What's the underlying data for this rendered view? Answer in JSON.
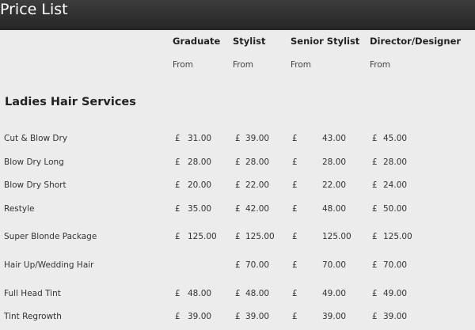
{
  "header": {
    "title": "Price List"
  },
  "columns": [
    {
      "label": "Graduate",
      "from": "From"
    },
    {
      "label": "Stylist",
      "from": "From"
    },
    {
      "label": "Senior Stylist",
      "from": "From"
    },
    {
      "label": "Director/Designer",
      "from": "From"
    }
  ],
  "section": {
    "title": "Ladies Hair Services"
  },
  "currency": "£",
  "services": [
    {
      "name": "Cut & Blow Dry",
      "prices": [
        "31.00",
        "39.00",
        "43.00",
        "45.00"
      ]
    },
    {
      "name": "Blow Dry Long",
      "prices": [
        "28.00",
        "28.00",
        "28.00",
        "28.00"
      ]
    },
    {
      "name": "Blow Dry Short",
      "prices": [
        "20.00",
        "22.00",
        "22.00",
        "24.00"
      ]
    },
    {
      "name": "Restyle",
      "prices": [
        "35.00",
        "42.00",
        "48.00",
        "50.00"
      ]
    },
    {
      "name": "Super Blonde Package",
      "prices": [
        "125.00",
        "125.00",
        "125.00",
        "125.00"
      ]
    },
    {
      "name": "Hair Up/Wedding Hair",
      "prices": [
        null,
        "70.00",
        "70.00",
        "70.00"
      ]
    },
    {
      "name": "Full Head Tint",
      "prices": [
        "48.00",
        "48.00",
        "49.00",
        "49.00"
      ]
    },
    {
      "name": "Tint Regrowth",
      "prices": [
        "39.00",
        "39.00",
        "39.00",
        "39.00"
      ]
    }
  ]
}
